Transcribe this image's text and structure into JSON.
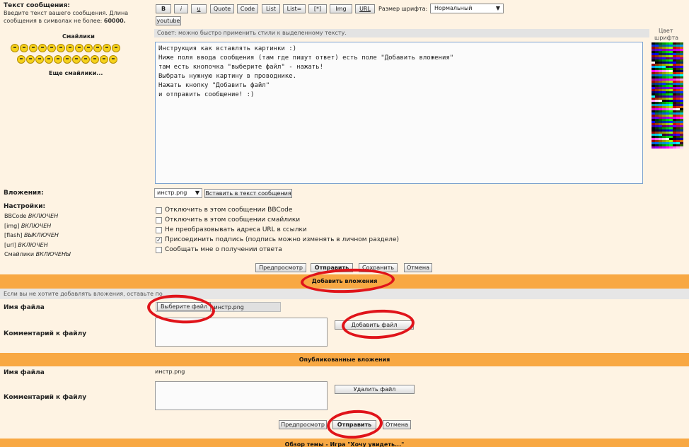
{
  "form": {
    "message_label": "Текст сообщения:",
    "message_hint": "Введите текст вашего сообщения. Длина сообщения в символах не более: ",
    "message_limit": "60000.",
    "smileys_label": "Смайлики",
    "more_smileys": "Еще смайлики...",
    "toolbar": {
      "bold": "B",
      "italic": "i",
      "underline": "u",
      "quote": "Quote",
      "code": "Code",
      "list": "List",
      "list_eq": "List=",
      "list_item": "[*]",
      "img": "Img",
      "url": "URL",
      "youtube": "youtube",
      "font_size_label": "Размер шрифта:",
      "font_size_value": "Нормальный"
    },
    "tip": "Совет: можно быстро применить стили к выделенному тексту.",
    "color_label_1": "Цвет",
    "color_label_2": "шрифта",
    "message_lines": [
      "Инструкция как вставлять картинки :)",
      "Ниже поля ввода сообщения (там где пишут ответ) есть поле \"Добавить вложения\"",
      "там есть кнопочка \"выберите файл\" - нажать!",
      "Выбрать нужную картину в проводнике.",
      "Нажать кнопку \"Добавить файл\"",
      "и отправить сообщение! :)"
    ],
    "attachments_label": "Вложения:",
    "attachment_select": "инстр.png",
    "insert_button": "Вставить в текст сообщения",
    "settings_label": "Настройки:",
    "settings_status": [
      {
        "name": "BBCode",
        "state": "ВКЛЮЧЕН"
      },
      {
        "name": "[img]",
        "state": "ВКЛЮЧЕН"
      },
      {
        "name": "[flash]",
        "state": "ВЫКЛЮЧЕН"
      },
      {
        "name": "[url]",
        "state": "ВКЛЮЧЕН"
      },
      {
        "name": "Смайлики",
        "state": "ВКЛЮЧЕНЫ"
      }
    ],
    "options": [
      {
        "label": "Отключить в этом сообщении BBCode",
        "checked": false
      },
      {
        "label": "Отключить в этом сообщении смайлики",
        "checked": false
      },
      {
        "label": "Не преобразовывать адреса URL в ссылки",
        "checked": false
      },
      {
        "label": "Присоединить подпись (подпись можно изменять в личном разделе)",
        "checked": true
      },
      {
        "label": "Сообщать мне о получении ответа",
        "checked": false
      }
    ],
    "actions": {
      "preview": "Предпросмотр",
      "send": "Отправить",
      "save": "Сохранить",
      "cancel": "Отмена"
    }
  },
  "add_attachments": {
    "title": "Добавить вложения",
    "hint": "Если вы не хотите добавлять вложения, оставьте по",
    "filename_label": "Имя файла",
    "choose_button": "Выберите файл",
    "chosen_file": "инстр.png",
    "comment_label": "Комментарий к файлу",
    "add_button": "Добавить файл"
  },
  "published": {
    "title": "Опубликованные вложения",
    "filename_label": "Имя файла",
    "filename_value": "инстр.png",
    "comment_label": "Комментарий к файлу",
    "delete_button": "Удалить файл",
    "actions": {
      "preview": "Предпросмотр",
      "send": "Отправить",
      "cancel": "Отмена"
    }
  },
  "footer": {
    "topic_overview": "Обзор темы - Игра \"Хочу увидеть...\""
  },
  "colors": {
    "orange_bar": "#f8a843",
    "background": "#fef3e3",
    "annotation": "#e0141a"
  }
}
